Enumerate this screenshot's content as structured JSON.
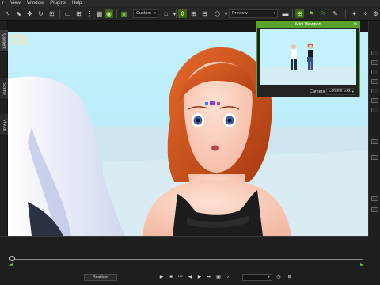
{
  "menu": {
    "items": [
      "r",
      "View",
      "Window",
      "Plugins",
      "Help"
    ]
  },
  "toolbar": {
    "camera_mode": "Custom",
    "view_preset": "Preview",
    "accent_color": "#7fd33a"
  },
  "side_tabs": {
    "tabs": [
      "Content",
      "Scene",
      "Visual"
    ]
  },
  "mini_viewport": {
    "title": "Mini Viewport",
    "close_glyph": "⊗",
    "camera_label": "Camera",
    "camera_option": "Content Exa"
  },
  "timeline": {
    "realtime_label": "Realtime",
    "start_marker": "◢",
    "end_marker": "◣"
  },
  "icons": {
    "select": "select-arrow-icon",
    "move": "move-icon",
    "rotate": "rotate-icon",
    "scale": "scale-icon",
    "eye": "eye-icon",
    "home": "home-icon",
    "play": "play-icon",
    "stop": "stop-icon"
  }
}
